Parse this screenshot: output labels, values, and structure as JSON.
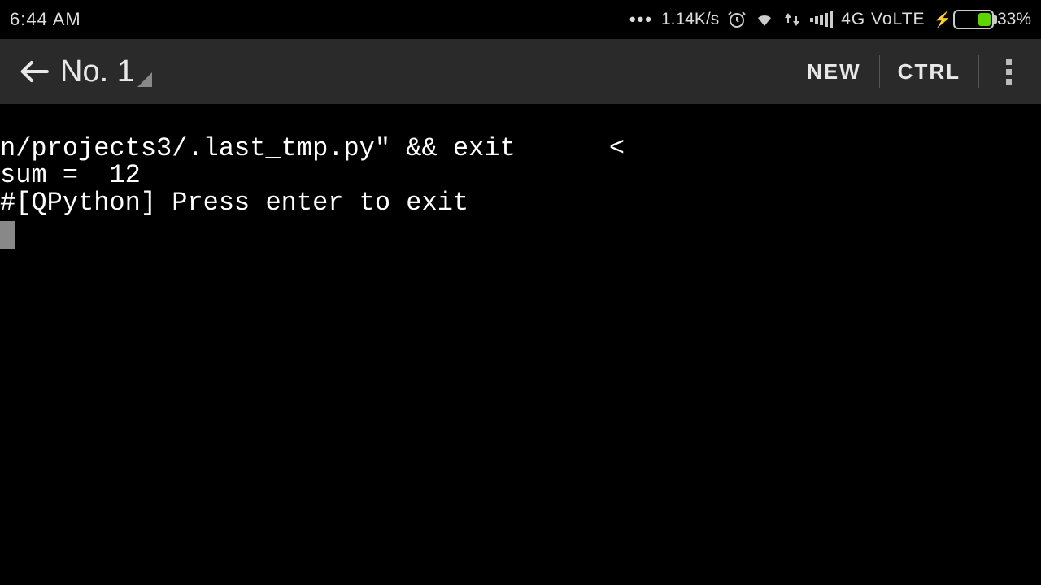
{
  "status": {
    "time": "6:44 AM",
    "speed": "1.14K/s",
    "network_label": "4G VoLTE",
    "battery_percent": "33%"
  },
  "appbar": {
    "title": "No. 1",
    "new_label": "NEW",
    "ctrl_label": "CTRL"
  },
  "terminal": {
    "line1": "n/projects3/.last_tmp.py\" && exit      <",
    "line2": "sum =  12",
    "line3": "",
    "line4": "#[QPython] Press enter to exit",
    "line5": ""
  }
}
